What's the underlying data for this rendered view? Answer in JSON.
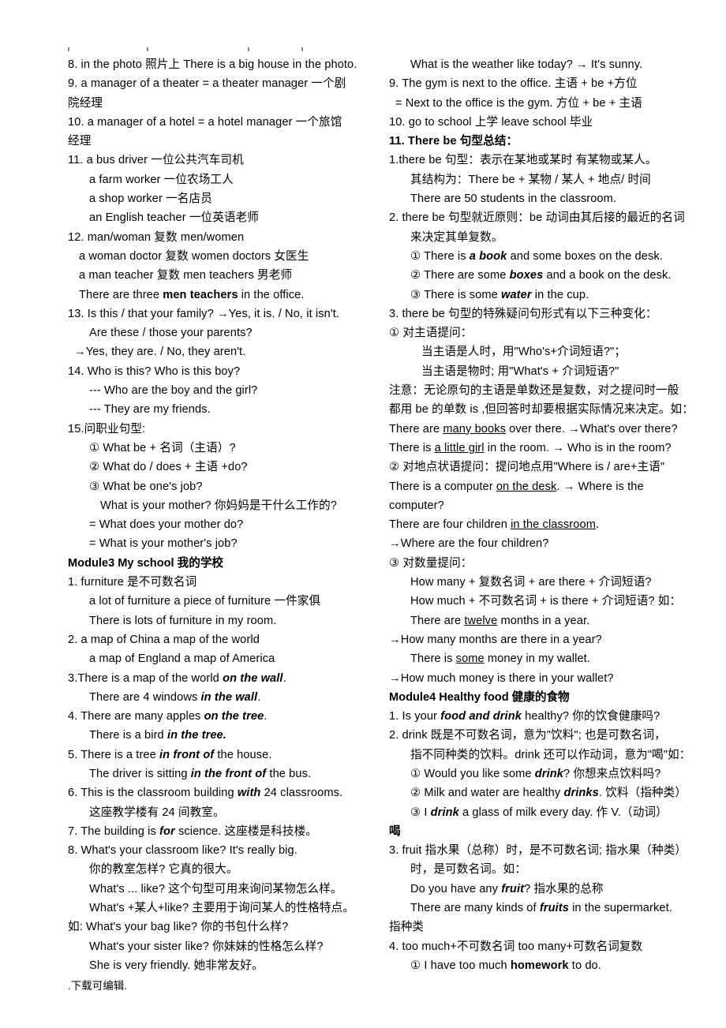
{
  "page": {
    "title_footer": ".下载可编辑.",
    "tick_marks": [
      "tick-1",
      "tick-2",
      "tick-3",
      "tick-4"
    ]
  },
  "left_column": {
    "lines": [
      {
        "id": "l1",
        "indent": "i1",
        "text": "8. in the photo  照片上   There is a big house in the photo."
      },
      {
        "id": "l2",
        "indent": "i1",
        "text": "9. a manager of a theater = a theater manager  一个剧"
      },
      {
        "id": "l3",
        "indent": "i1",
        "text": "院经理"
      },
      {
        "id": "l4",
        "indent": "i1",
        "text": "10. a manager of a hotel = a hotel manager   一个旅馆"
      },
      {
        "id": "l5",
        "indent": "i1",
        "text": "经理"
      },
      {
        "id": "l6",
        "indent": "i1",
        "text": "11. a bus driver  一位公共汽车司机"
      },
      {
        "id": "l7",
        "indent": "i3",
        "text": "a farm worker  一位农场工人"
      },
      {
        "id": "l8",
        "indent": "i3",
        "text": "a shop worker   一名店员"
      },
      {
        "id": "l9",
        "indent": "i3",
        "text": "an English teacher  一位英语老师"
      },
      {
        "id": "l10",
        "indent": "i1",
        "text": "12. man/woman  复数   men/women"
      },
      {
        "id": "l11",
        "indent": "i2",
        "text": "a woman doctor  复数 women doctors  女医生"
      },
      {
        "id": "l12",
        "indent": "i2",
        "text": "a man teacher  复数  men teachers   男老师"
      },
      {
        "id": "l13",
        "indent": "i2",
        "html": "There are three <b>men teachers</b> in the office."
      },
      {
        "id": "l14",
        "indent": "i1",
        "text": "13. Is this / that your family?   →Yes, it is. / No, it isn't."
      },
      {
        "id": "l15",
        "indent": "i3",
        "text": "Are these / those your parents?"
      },
      {
        "id": "l16",
        "indent": "i5",
        "text": "→Yes, they are. / No, they aren't."
      },
      {
        "id": "l17",
        "indent": "i1",
        "text": "14. Who is this?    Who is this boy?"
      },
      {
        "id": "l18",
        "indent": "i3",
        "text": "--- Who are the boy and the girl?"
      },
      {
        "id": "l19",
        "indent": "i3",
        "text": "--- They are my friends."
      },
      {
        "id": "l20",
        "indent": "i1",
        "text": "15.问职业句型:"
      },
      {
        "id": "l21",
        "indent": "i3",
        "text": "① What be +  名词（主语）?"
      },
      {
        "id": "l22",
        "indent": "i3",
        "text": "② What do / does +  主语 +do?"
      },
      {
        "id": "l23",
        "indent": "i3",
        "text": "③ What be one's job?"
      },
      {
        "id": "l24",
        "indent": "i4",
        "text": "What is your mother?  你妈妈是干什么工作的?"
      },
      {
        "id": "l25",
        "indent": "i3",
        "text": "= What does your mother do?"
      },
      {
        "id": "l26",
        "indent": "i3",
        "text": "= What is your mother's job?"
      }
    ],
    "module3": {
      "heading": "Module3   My school 我的学校",
      "lines": [
        {
          "id": "m3l1",
          "indent": "i1",
          "text": "1. furniture 是不可数名词"
        },
        {
          "id": "m3l2",
          "indent": "i3",
          "text": "a lot of furniture    a piece of furniture  一件家俱"
        },
        {
          "id": "m3l3",
          "indent": "i3",
          "text": "There is lots of furniture in my room."
        },
        {
          "id": "m3l4",
          "indent": "i1",
          "text": "2. a map of China           a map of the world"
        },
        {
          "id": "m3l5",
          "indent": "i3",
          "text": "a map of England       a map of America"
        },
        {
          "id": "m3l6",
          "indent": "i1",
          "html": "3.There is a map of the world <span class=\"bi\">on the wall</span>."
        },
        {
          "id": "m3l7",
          "indent": "i3",
          "html": "There are 4 windows <span class=\"bi\">in the wall</span>."
        },
        {
          "id": "m3l8",
          "indent": "i1",
          "html": "4. There are many apples <span class=\"bi\">on the tree</span>."
        },
        {
          "id": "m3l9",
          "indent": "i3",
          "html": "There is a bird <span class=\"bi\">in the tree.</span>"
        },
        {
          "id": "m3l10",
          "indent": "i1",
          "html": "5. There is a tree <span class=\"bi\">in front of</span> the house."
        },
        {
          "id": "m3l11",
          "indent": "i3",
          "html": "The driver is sitting <span class=\"bi\">in the front of</span> the bus."
        },
        {
          "id": "m3l12",
          "indent": "i1",
          "html": "6. This is the classroom building <span class=\"bi\">with</span> 24 classrooms."
        },
        {
          "id": "m3l13",
          "indent": "i3",
          "text": "这座教学楼有 24 间教室。"
        },
        {
          "id": "m3l14",
          "indent": "i1",
          "html": "7. The building is <span class=\"bi\">for</span> science.    这座楼是科技楼。"
        },
        {
          "id": "m3l15",
          "indent": "i1",
          "text": "8. What's your classroom like?   It's really big."
        },
        {
          "id": "m3l16",
          "indent": "i3",
          "text": "你的教室怎样? 它真的很大。"
        },
        {
          "id": "m3l17",
          "indent": "i3",
          "text": "What's ... like? 这个句型可用来询问某物怎么样。"
        },
        {
          "id": "m3l18",
          "indent": "i3",
          "text": "What's +某人+like?  主要用于询问某人的性格特点。"
        },
        {
          "id": "m3l19",
          "indent": "i1",
          "text": "如: What's your bag like?  你的书包什么样?"
        },
        {
          "id": "m3l20",
          "indent": "i3",
          "text": "What's your sister like?  你妹妹的性格怎么样?"
        },
        {
          "id": "m3l21",
          "indent": "i3",
          "text": "She is very friendly.  她非常友好。"
        }
      ]
    }
  },
  "right_column": {
    "lines": [
      {
        "id": "r1",
        "indent": "i3",
        "text": "What is the weather like today?  →  It's sunny."
      },
      {
        "id": "r2",
        "indent": "i1",
        "text": "9. The gym is next to the office. 主语 + be +方位"
      },
      {
        "id": "r3",
        "indent": "i5",
        "text": "= Next to the office is the gym. 方位 + be + 主语"
      },
      {
        "id": "r4",
        "indent": "i1",
        "text": "10. go to school 上学     leave school 毕业"
      },
      {
        "id": "r5",
        "indent": "i1",
        "bold": true,
        "text": "11. There be 句型总结："
      },
      {
        "id": "r6",
        "indent": "i1",
        "text": "1.there be 句型：表示在某地或某时 有某物或某人。"
      },
      {
        "id": "r7",
        "indent": "i3",
        "text": "其结构为：There be +  某物 / 某人 + 地点/ 时间"
      },
      {
        "id": "r8",
        "indent": "i3",
        "text": "There are 50 students in the classroom."
      },
      {
        "id": "r9",
        "indent": "i1",
        "text": "2. there be 句型就近原则：be 动词由其后接的最近的名词"
      },
      {
        "id": "r10",
        "indent": "i3",
        "text": "来决定其单复数。"
      },
      {
        "id": "r11",
        "indent": "i3",
        "html": "① There is <span class=\"bi\">a book</span> and some boxes on the desk."
      },
      {
        "id": "r12",
        "indent": "i3",
        "html": "② There are some <span class=\"bi\">boxes</span> and a book on the desk."
      },
      {
        "id": "r13",
        "indent": "i3",
        "html": "③ There is some <span class=\"bi\">water</span> in the cup."
      },
      {
        "id": "r14",
        "indent": "i1",
        "text": "3. there be 句型的特殊疑问句形式有以下三种变化："
      },
      {
        "id": "r15",
        "indent": "i1",
        "text": "① 对主语提问："
      },
      {
        "id": "r16",
        "indent": "i4",
        "text": "当主语是人时，用\"Who's+介词短语?\"；"
      },
      {
        "id": "r17",
        "indent": "i4",
        "text": "当主语是物时; 用\"What's + 介词短语?\""
      },
      {
        "id": "r18",
        "indent": "i1",
        "text": "注意：无论原句的主语是单数还是复数，对之提问时一般"
      },
      {
        "id": "r19",
        "indent": "i1",
        "text": "都用 be 的单数 is ,但回答时却要根据实际情况来决定。如："
      },
      {
        "id": "r20",
        "indent": "i1",
        "html": "There are <u>many books</u> over there. →What's over there?"
      },
      {
        "id": "r21",
        "indent": "i1",
        "html": "There is <u>a little girl</u> in the room.  →  Who is in the room?"
      },
      {
        "id": "r22",
        "indent": "i1",
        "text": "② 对地点状语提问：提问地点用\"Where is / are+主语\""
      },
      {
        "id": "r23",
        "indent": "i1",
        "html": "There is a computer <u>on the desk</u>.  →  Where is the"
      },
      {
        "id": "r24",
        "indent": "i1",
        "text": "computer?"
      },
      {
        "id": "r25",
        "indent": "i1",
        "html": "There are four children <u>in the classroom</u>."
      },
      {
        "id": "r26",
        "indent": "i1",
        "text": "→Where are the four children?"
      },
      {
        "id": "r27",
        "indent": "i1",
        "text": "③ 对数量提问："
      },
      {
        "id": "r28",
        "indent": "i3",
        "text": "How many +  复数名词 + are there + 介词短语?"
      },
      {
        "id": "r29",
        "indent": "i3",
        "text": "How much + 不可数名词 + is there + 介词短语? 如："
      },
      {
        "id": "r30",
        "indent": "i3",
        "html": "There are <u>twelve</u> months in a year."
      },
      {
        "id": "r31",
        "indent": "i1",
        "text": "→How many months are there in a year?"
      },
      {
        "id": "r32",
        "indent": "i3",
        "html": "There is <u>some</u> money in my wallet."
      },
      {
        "id": "r33",
        "indent": "i1",
        "text": "→How much money is there in your wallet?"
      }
    ],
    "module4": {
      "heading": "Module4     Healthy food 健康的食物",
      "lines": [
        {
          "id": "m4l1",
          "indent": "i1",
          "html": "1. Is your <span class=\"bi\">food and drink</span> healthy?     你的饮食健康吗?"
        },
        {
          "id": "m4l2",
          "indent": "i1",
          "text": "2. drink 既是不可数名词，意为\"饮料\"; 也是可数名词，"
        },
        {
          "id": "m4l3",
          "indent": "i3",
          "text": "指不同种类的饮料。drink 还可以作动词，意为\"喝\"如："
        },
        {
          "id": "m4l4",
          "indent": "i3",
          "html": "① Would you like some <span class=\"bi\">drink</span>?   你想来点饮料吗?"
        },
        {
          "id": "m4l5",
          "indent": "i3",
          "html": "② Milk and water are healthy <span class=\"bi\">drinks</span>. 饮料（指种类）"
        },
        {
          "id": "m4l6",
          "indent": "i3",
          "html": "③ I <span class=\"bi\">drink</span> a glass of milk every day.    作 V.（动词）"
        },
        {
          "id": "m4l7",
          "indent": "i1",
          "bold": true,
          "text": "喝"
        },
        {
          "id": "m4l8",
          "indent": "i1",
          "text": "3. fruit 指水果（总称）时，是不可数名词; 指水果（种类）"
        },
        {
          "id": "m4l9",
          "indent": "i3",
          "text": "时，是可数名词。如："
        },
        {
          "id": "m4l10",
          "indent": "i3",
          "html": "Do you have any <span class=\"bi\">fruit</span>?    指水果的总称"
        },
        {
          "id": "m4l11",
          "indent": "i3",
          "html": "There are many kinds of <span class=\"bi\">fruits</span> in the supermarket."
        },
        {
          "id": "m4l12",
          "indent": "i1",
          "text": "指种类"
        },
        {
          "id": "m4l13",
          "indent": "i1",
          "text": "4. too much+不可数名词     too many+可数名词复数"
        },
        {
          "id": "m4l14",
          "indent": "i3",
          "html": "① I have too much <b>homework</b> to do."
        }
      ]
    }
  }
}
